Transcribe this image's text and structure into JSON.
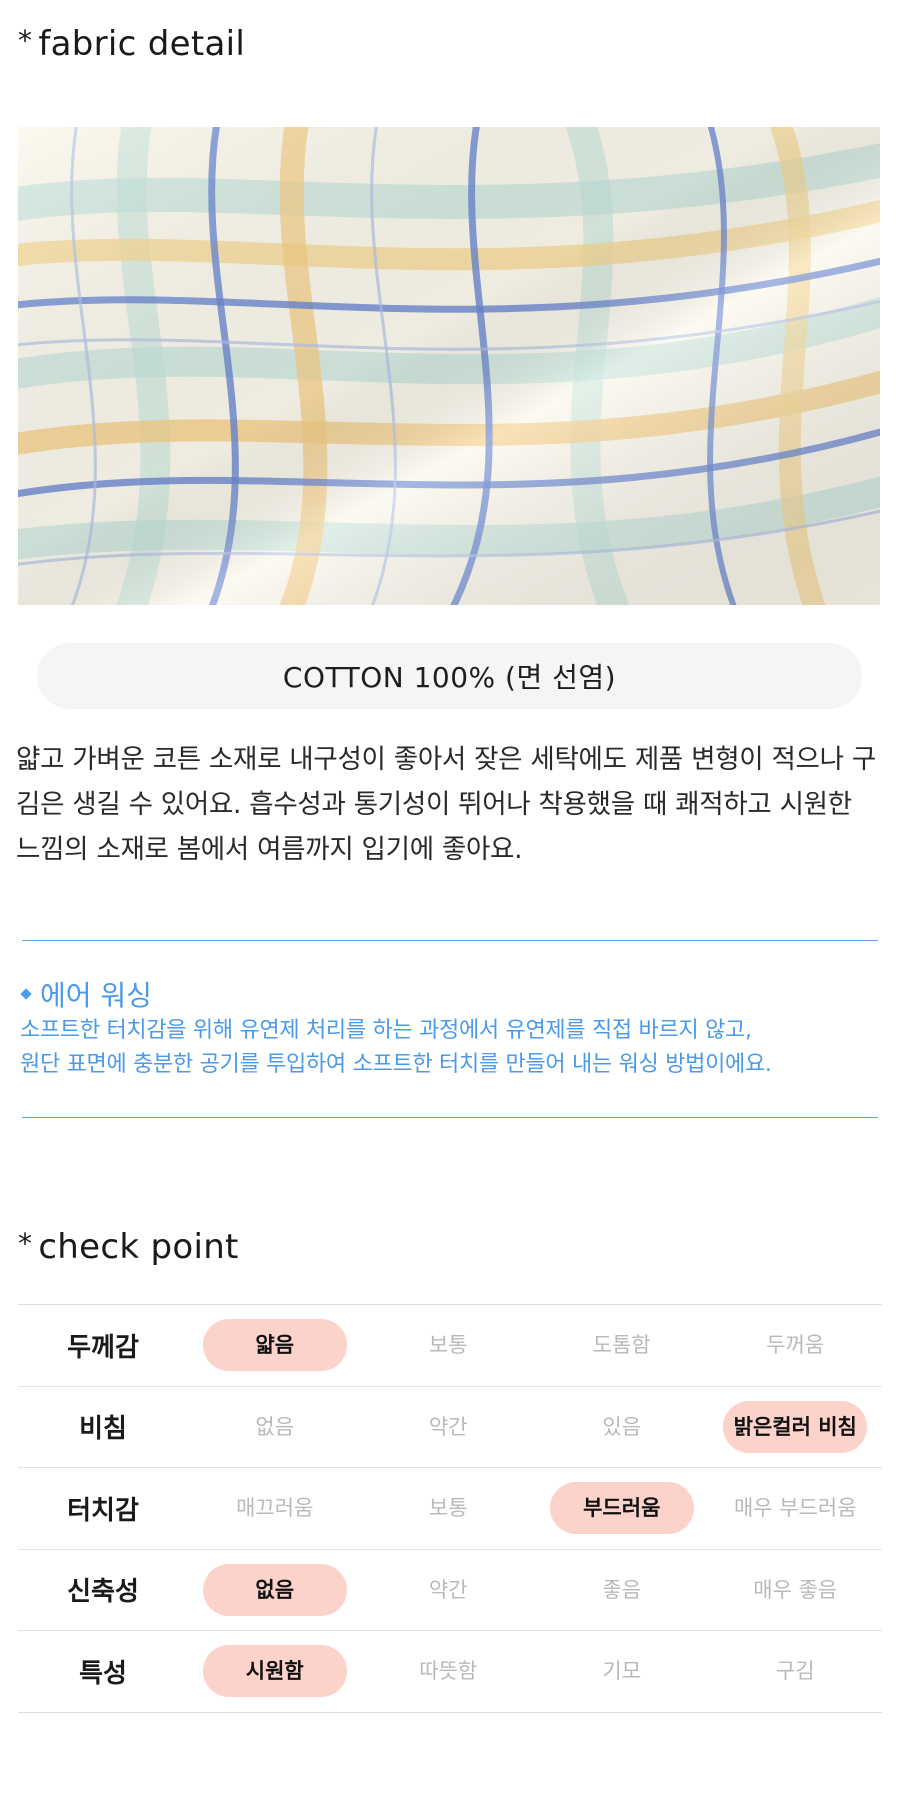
{
  "fabric_section": {
    "title": "fabric detail",
    "bullet": "*",
    "composition": "COTTON 100% (면 선염)",
    "description": "얇고 가벼운 코튼 소재로 내구성이 좋아서 잦은 세탁에도 제품 변형이 적으나 구김은 생길 수 있어요. 흡수성과 통기성이 뛰어나 착용했을 때 쾌적하고 시원한 느낌의 소재로 봄에서 여름까지 입기에 좋아요."
  },
  "air_washing": {
    "title": "에어 워싱",
    "line1": "소프트한 터치감을 위해 유연제 처리를 하는 과정에서 유연제를 직접 바르지 않고,",
    "line2": "원단 표면에 충분한 공기를 투입하여 소프트한 터치를 만들어 내는 워싱 방법이에요.",
    "color": "#4a9ae8"
  },
  "check_section": {
    "title": "check point",
    "bullet": "*",
    "highlight_color": "#fcd3cb",
    "rows": [
      {
        "label": "두께감",
        "options": [
          "얇음",
          "보통",
          "도톰함",
          "두꺼움"
        ],
        "selected": 0
      },
      {
        "label": "비침",
        "options": [
          "없음",
          "약간",
          "있음",
          "밝은컬러 비침"
        ],
        "selected": 3
      },
      {
        "label": "터치감",
        "options": [
          "매끄러움",
          "보통",
          "부드러움",
          "매우 부드러움"
        ],
        "selected": 2
      },
      {
        "label": "신축성",
        "options": [
          "없음",
          "약간",
          "좋음",
          "매우 좋음"
        ],
        "selected": 0
      },
      {
        "label": "특성",
        "options": [
          "시원함",
          "따뜻함",
          "기모",
          "구김"
        ],
        "selected": 0
      }
    ]
  }
}
